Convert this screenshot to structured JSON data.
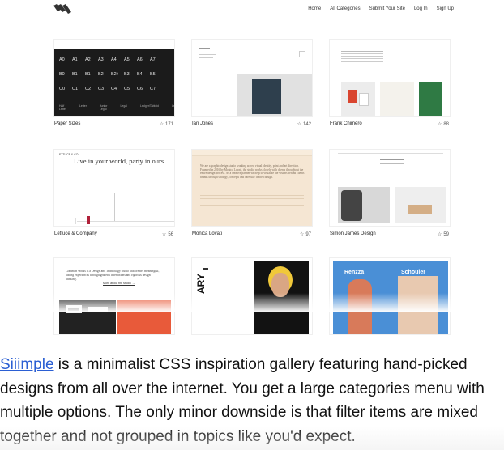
{
  "nav": {
    "links": [
      "Home",
      "All Categories",
      "Submit Your Site",
      "Log In",
      "Sign Up"
    ]
  },
  "gallery": [
    {
      "title": "Paper Sizes",
      "stars": "171"
    },
    {
      "title": "Ian Jones",
      "stars": "142"
    },
    {
      "title": "Frank Chimero",
      "stars": "88"
    },
    {
      "title": "Lettuce & Company",
      "stars": "56"
    },
    {
      "title": "Monica Lovati",
      "stars": "97"
    },
    {
      "title": "Simon James Design",
      "stars": "59"
    }
  ],
  "thumbs": {
    "paper_sizes": {
      "rows": [
        [
          "A0",
          "A1",
          "A2",
          "A3",
          "A4",
          "A5",
          "A6",
          "A7",
          "A8"
        ],
        [
          "B0",
          "B1",
          "B1+",
          "B2",
          "B2+",
          "B3",
          "B4",
          "B5",
          "B6"
        ],
        [
          "C0",
          "C1",
          "C2",
          "C3",
          "C4",
          "C5",
          "C6",
          "C7",
          "C8"
        ]
      ],
      "footer": [
        "Half Letter",
        "Letter",
        "Junior Legal",
        "Legal",
        "Ledger/Tabloid",
        "Legal"
      ]
    },
    "lettuce_tagline": "Live in your world, party in ours.",
    "lettuce_logo": "LETTUCE & CO",
    "lovati_text": "We are a graphic design studio working across visual identity, print and art direction. Founded in 2016 by Monica Lovati, the studio works closely with clients throughout the entire design process. As a creative partner we help to visualize the visions behind clients' brands through strategy, concepts and carefully crafted design.",
    "gw_text": "Common Works is a Design and Technology studio that creates meaningful, lasting experiences through graceful interactions and rigorous design thinking.",
    "gw_link": "More about the studio →",
    "third_row_label": "ARY",
    "fashion_words": [
      "Renzza",
      "Schouler"
    ]
  },
  "caption": {
    "link": "Siiimple",
    "text": " is a minimalist CSS inspiration gallery featuring hand-picked designs from all over the internet. You get a large categories menu with multiple options. The only minor downside is that filter items are mixed together and not grouped in topics like you'd expect."
  },
  "colors": {
    "link": "#2b5fd3",
    "lettuce_accent": "#b0213a",
    "lovati_bg": "#f5e6d3",
    "fashion_blue": "#4a8fd6"
  }
}
